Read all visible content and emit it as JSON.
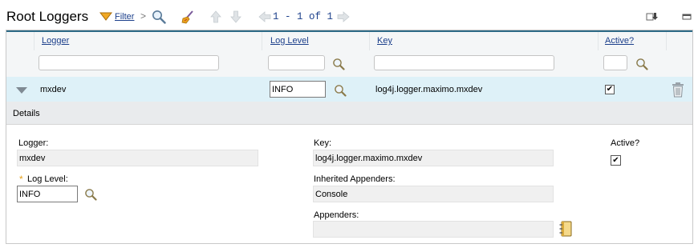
{
  "toolbar": {
    "title": "Root Loggers",
    "filter_label": "Filter",
    "pagination": "1 - 1 of 1"
  },
  "table": {
    "columns": [
      "Logger",
      "Log Level",
      "Key",
      "Active?"
    ],
    "filters": {
      "logger": "",
      "log_level": "",
      "key": "",
      "active": ""
    },
    "rows": [
      {
        "logger": "mxdev",
        "log_level": "INFO",
        "key": "log4j.logger.maximo.mxdev",
        "active": true
      }
    ]
  },
  "details": {
    "section_title": "Details",
    "logger_label": "Logger:",
    "logger_value": "mxdev",
    "log_level_label": "Log Level:",
    "log_level_value": "INFO",
    "required_marker": "*",
    "key_label": "Key:",
    "key_value": "log4j.logger.maximo.mxdev",
    "inherited_label": "Inherited Appenders:",
    "inherited_value": "Console",
    "appenders_label": "Appenders:",
    "appenders_value": "",
    "active_label": "Active?",
    "active_checked": true
  },
  "icons": {
    "filter": "filter-funnel-icon",
    "find": "magnifier-icon",
    "clear": "clear-filter-broom-icon",
    "prev_row": "arrow-up-icon",
    "next_row": "arrow-down-icon",
    "prev_page": "arrow-left-icon",
    "next_page": "arrow-right-icon",
    "download": "download-icon",
    "minimize": "minimize-icon",
    "expand": "row-expand-triangle-icon",
    "delete": "trash-icon",
    "select_value": "notebook-select-icon"
  },
  "colors": {
    "accent": "#2d6a86",
    "link": "#1b3f8b",
    "row_highlight": "#def1f8",
    "header_bg": "#f4f6f7",
    "detail_header_bg": "#e9ebed"
  }
}
